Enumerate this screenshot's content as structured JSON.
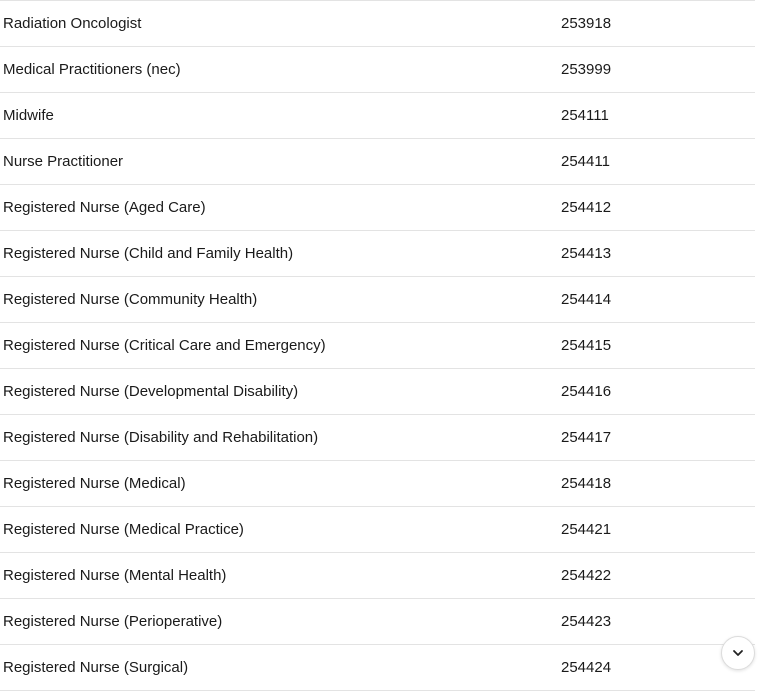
{
  "rows": [
    {
      "title": "Radiation Oncologist",
      "code": "253918"
    },
    {
      "title": "Medical Practitioners (nec)",
      "code": "253999"
    },
    {
      "title": "Midwife",
      "code": "254111"
    },
    {
      "title": "Nurse Practitioner",
      "code": "254411"
    },
    {
      "title": "Registered Nurse (Aged Care)",
      "code": "254412"
    },
    {
      "title": "Registered Nurse (Child and Family Health)",
      "code": "254413"
    },
    {
      "title": "Registered Nurse (Community Health)",
      "code": "254414"
    },
    {
      "title": "Registered Nurse (Critical Care and Emergency)",
      "code": "254415"
    },
    {
      "title": "Registered Nurse (Developmental Disability)",
      "code": "254416"
    },
    {
      "title": "Registered Nurse (Disability and Rehabilitation)",
      "code": "254417"
    },
    {
      "title": "Registered Nurse (Medical)",
      "code": "254418"
    },
    {
      "title": "Registered Nurse (Medical Practice)",
      "code": "254421"
    },
    {
      "title": "Registered Nurse (Mental Health)",
      "code": "254422"
    },
    {
      "title": "Registered Nurse (Perioperative)",
      "code": "254423"
    },
    {
      "title": "Registered Nurse (Surgical)",
      "code": "254424"
    }
  ],
  "scroll_button": {
    "icon": "chevron-down-icon"
  }
}
